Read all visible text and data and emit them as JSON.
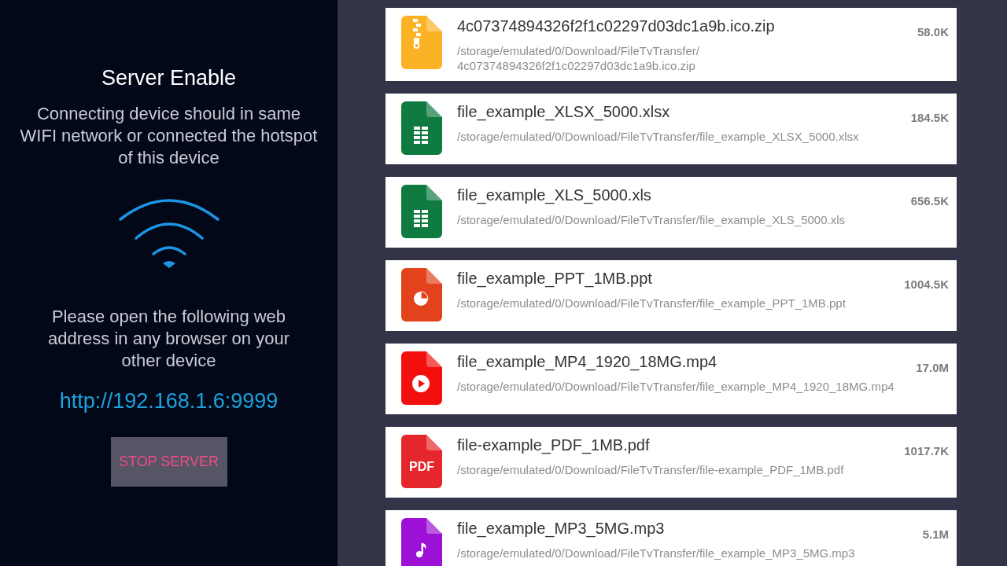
{
  "server": {
    "title": "Server Enable",
    "note": "Connecting device should in same WIFI network or connected the hotspot of this device",
    "instruction": "Please open the following web address in any browser on your other device",
    "address": "http://192.168.1.6:9999",
    "button": "STOP SERVER"
  },
  "files": [
    {
      "kind": "zip",
      "name": "4c07374894326f2f1c02297d03dc1a9b.ico.zip",
      "path": "/storage/emulated/0/Download/FileTvTransfer/ 4c07374894326f2f1c02297d03dc1a9b.ico.zip",
      "size": "58.0K"
    },
    {
      "kind": "sheet",
      "name": "file_example_XLSX_5000.xlsx",
      "path": "/storage/emulated/0/Download/FileTvTransfer/file_example_XLSX_5000.xlsx",
      "size": "184.5K"
    },
    {
      "kind": "sheet",
      "name": "file_example_XLS_5000.xls",
      "path": "/storage/emulated/0/Download/FileTvTransfer/file_example_XLS_5000.xls",
      "size": "656.5K"
    },
    {
      "kind": "slides",
      "name": "file_example_PPT_1MB.ppt",
      "path": "/storage/emulated/0/Download/FileTvTransfer/file_example_PPT_1MB.ppt",
      "size": "1004.5K"
    },
    {
      "kind": "video",
      "name": "file_example_MP4_1920_18MG.mp4",
      "path": "/storage/emulated/0/Download/FileTvTransfer/file_example_MP4_1920_18MG.mp4",
      "size": "17.0M"
    },
    {
      "kind": "pdf",
      "icon_label": "PDF",
      "name": "file-example_PDF_1MB.pdf",
      "path": "/storage/emulated/0/Download/FileTvTransfer/file-example_PDF_1MB.pdf",
      "size": "1017.7K"
    },
    {
      "kind": "audio",
      "name": "file_example_MP3_5MG.mp3",
      "path": "/storage/emulated/0/Download/FileTvTransfer/file_example_MP3_5MG.mp3",
      "size": "5.1M"
    }
  ]
}
